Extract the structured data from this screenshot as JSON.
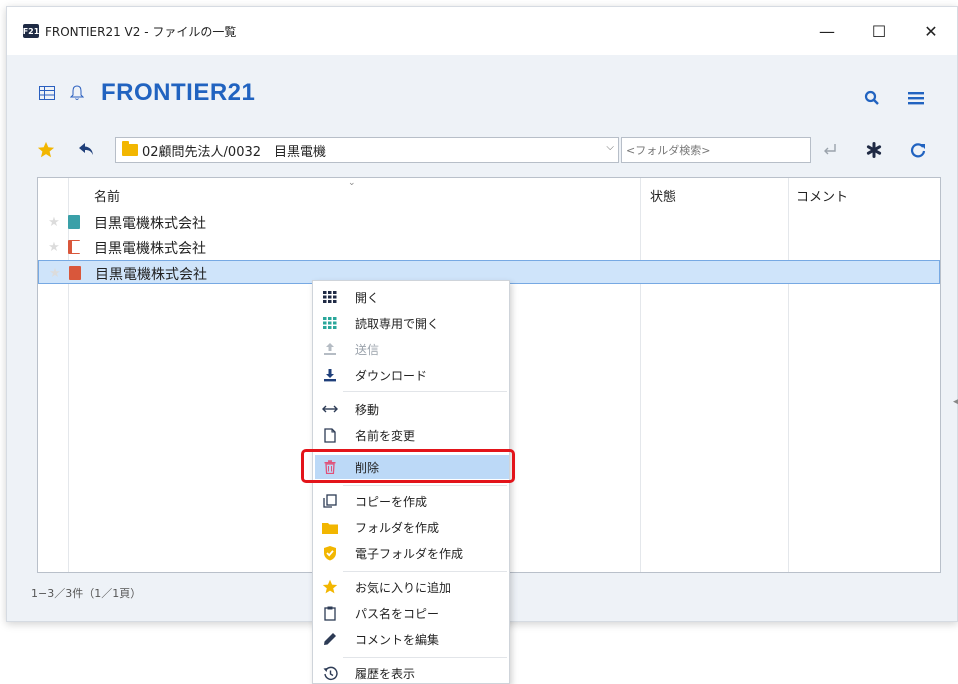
{
  "window": {
    "app_badge": "F21",
    "title": "FRONTIER21 V2 - ファイルの一覧",
    "minimize": "—",
    "maximize": "☐",
    "close": "✕"
  },
  "header": {
    "brand": "FRONTIER21"
  },
  "pathbar": {
    "path": "02顧問先法人/0032　目黒電機",
    "search_placeholder": "<フォルダ検索>"
  },
  "columns": {
    "name": "名前",
    "status": "状態",
    "comment": "コメント"
  },
  "files": [
    {
      "name": "目黒電機株式会社",
      "icon_color": "#3aa0a8"
    },
    {
      "name": "目黒電機株式会社",
      "icon_color": "#d9573b"
    },
    {
      "name": "目黒電機株式会社",
      "icon_color": "#d9573b"
    }
  ],
  "status_text": "1−3／3件（1／1頁）",
  "context_menu": [
    {
      "label": "開く",
      "icon": "grid-icon",
      "color": "#1f2a44"
    },
    {
      "label": "読取専用で開く",
      "icon": "grid-icon",
      "color": "#2aa79b"
    },
    {
      "label": "送信",
      "icon": "upload-icon",
      "color": "#b5bcc4",
      "disabled": true
    },
    {
      "label": "ダウンロード",
      "icon": "download-icon",
      "color": "#1f3f7a"
    },
    {
      "label": "移動",
      "icon": "move-icon",
      "color": "#2d3b55"
    },
    {
      "label": "名前を変更",
      "icon": "document-icon",
      "color": "#2d3b55"
    },
    {
      "label": "削除",
      "icon": "trash-icon",
      "color": "#e0527a"
    },
    {
      "label": "コピーを作成",
      "icon": "copy-icon",
      "color": "#2d3b55"
    },
    {
      "label": "フォルダを作成",
      "icon": "folder-icon",
      "color": "#f2b600"
    },
    {
      "label": "電子フォルダを作成",
      "icon": "shield-check-icon",
      "color": "#f2b600"
    },
    {
      "label": "お気に入りに追加",
      "icon": "star-icon",
      "color": "#f2b600"
    },
    {
      "label": "パス名をコピー",
      "icon": "clipboard-icon",
      "color": "#2d3b55"
    },
    {
      "label": "コメントを編集",
      "icon": "pencil-icon",
      "color": "#2d3b55"
    },
    {
      "label": "履歴を表示",
      "icon": "history-icon",
      "color": "#2d3b55"
    }
  ],
  "colors": {
    "brand": "#2163c0",
    "highlight": "#e3141a",
    "selection": "#cfe4fa"
  }
}
